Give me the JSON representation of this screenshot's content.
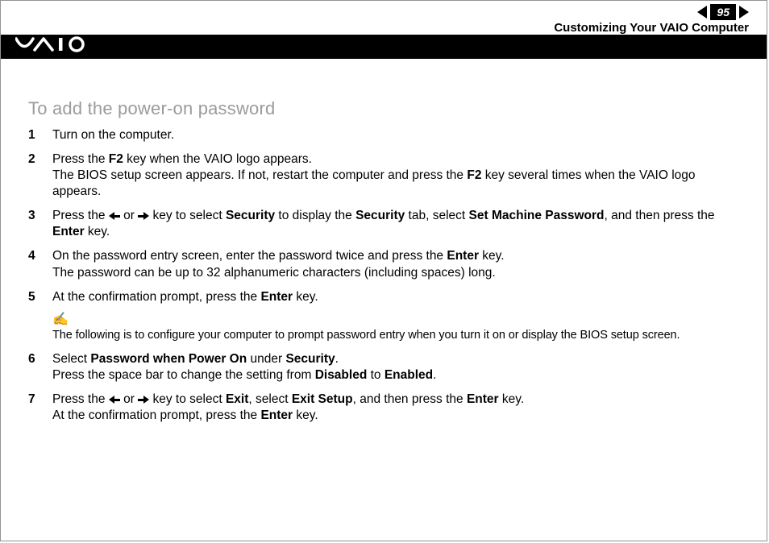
{
  "header": {
    "page_number": "95",
    "breadcrumb": "Customizing Your VAIO Computer"
  },
  "section": {
    "title": "To add the power-on password"
  },
  "steps": {
    "s1": {
      "num": "1",
      "text": "Turn on the computer."
    },
    "s2": {
      "num": "2",
      "line1_a": "Press the ",
      "line1_b_bold": "F2",
      "line1_c": " key when the VAIO logo appears.",
      "line2_a": "The BIOS setup screen appears. If not, restart the computer and press the ",
      "line2_b_bold": "F2",
      "line2_c": " key several times when the VAIO logo appears."
    },
    "s3": {
      "num": "3",
      "a": "Press the ",
      "b": " or ",
      "c": " key to select ",
      "d_bold": "Security",
      "e": " to display the ",
      "f_bold": "Security",
      "g": " tab, select ",
      "h_bold": "Set Machine Password",
      "i": ", and then press the ",
      "j_bold": "Enter",
      "k": " key."
    },
    "s4": {
      "num": "4",
      "line1_a": "On the password entry screen, enter the password twice and press the ",
      "line1_b_bold": "Enter",
      "line1_c": " key.",
      "line2": "The password can be up to 32 alphanumeric characters (including spaces) long."
    },
    "s5": {
      "num": "5",
      "a": "At the confirmation prompt, press the ",
      "b_bold": "Enter",
      "c": " key."
    },
    "note": {
      "text": "The following is to configure your computer to prompt password entry when you turn it on or display the BIOS setup screen."
    },
    "s6": {
      "num": "6",
      "line1_a": "Select ",
      "line1_b_bold": "Password when Power On",
      "line1_c": " under ",
      "line1_d_bold": "Security",
      "line1_e": ".",
      "line2_a": "Press the space bar to change the setting from ",
      "line2_b_bold": "Disabled",
      "line2_c": " to ",
      "line2_d_bold": "Enabled",
      "line2_e": "."
    },
    "s7": {
      "num": "7",
      "line1_a": "Press the ",
      "line1_b": " or ",
      "line1_c": " key to select ",
      "line1_d_bold": "Exit",
      "line1_e": ", select ",
      "line1_f_bold": "Exit Setup",
      "line1_g": ", and then press the ",
      "line1_h_bold": "Enter",
      "line1_i": " key.",
      "line2_a": "At the confirmation prompt, press the ",
      "line2_b_bold": "Enter",
      "line2_c": " key."
    }
  }
}
